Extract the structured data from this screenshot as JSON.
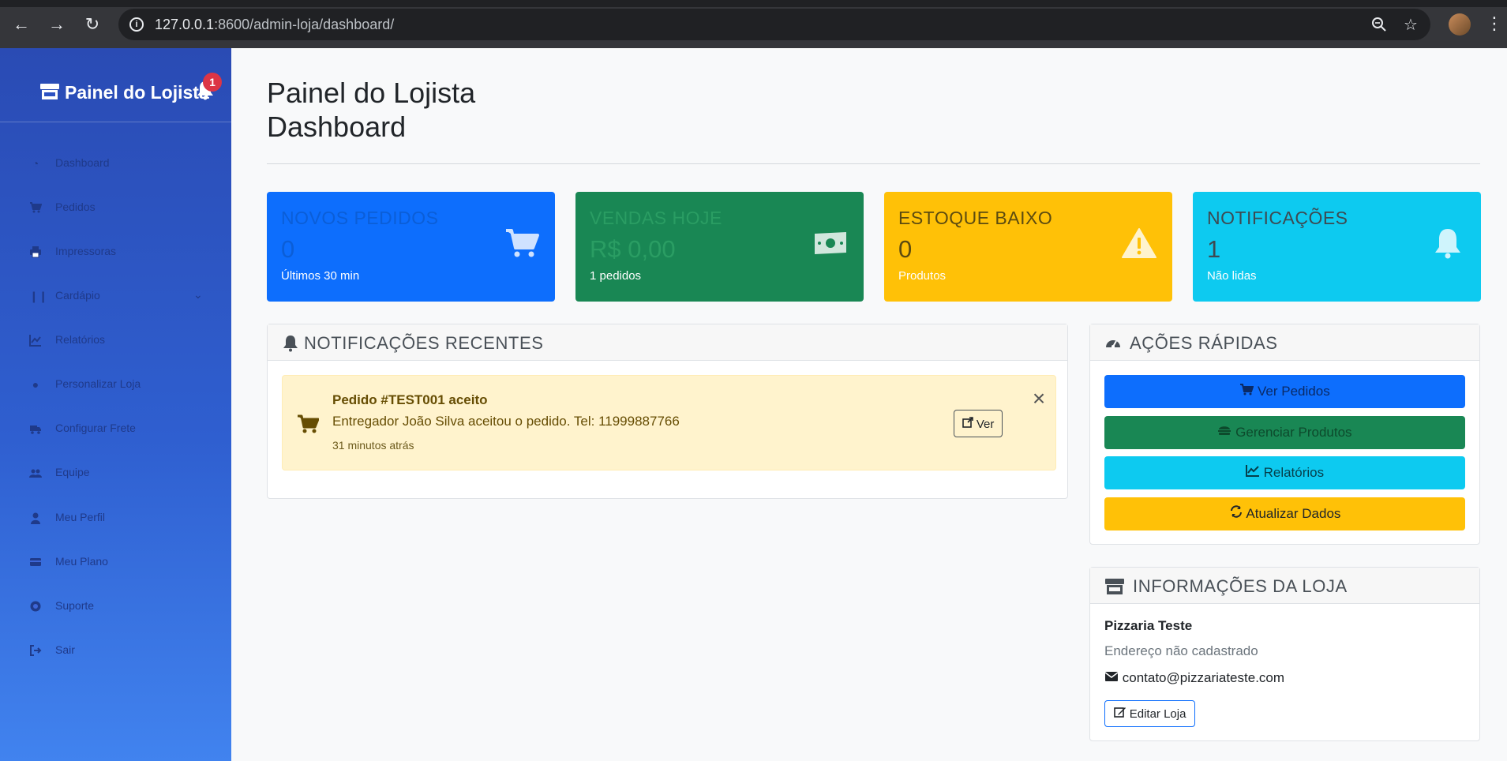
{
  "browser": {
    "url_host": "127.0.0.1",
    "url_path": ":8600/admin-loja/dashboard/"
  },
  "sidebar": {
    "brand": "Painel do Lojista",
    "notification_count": "1",
    "items": [
      {
        "label": "Dashboard",
        "icon": "gauge-icon"
      },
      {
        "label": "Pedidos",
        "icon": "cart-icon"
      },
      {
        "label": "Impressoras",
        "icon": "printer-icon"
      },
      {
        "label": "Cardápio",
        "icon": "utensils-icon"
      },
      {
        "label": "Relatórios",
        "icon": "chart-line-icon"
      },
      {
        "label": "Personalizar Loja",
        "icon": "palette-icon"
      },
      {
        "label": "Configurar Frete",
        "icon": "truck-icon"
      },
      {
        "label": "Equipe",
        "icon": "users-icon"
      },
      {
        "label": "Meu Perfil",
        "icon": "user-icon"
      },
      {
        "label": "Meu Plano",
        "icon": "credit-card-icon"
      },
      {
        "label": "Suporte",
        "icon": "life-ring-icon"
      },
      {
        "label": "Sair",
        "icon": "sign-out-icon"
      }
    ]
  },
  "header": {
    "title_line1": "Painel do Lojista",
    "title_line2": "Dashboard"
  },
  "stats": [
    {
      "title": "NOVOS PEDIDOS",
      "value": "0",
      "sub": "Últimos 30 min",
      "color": "#0d6efd",
      "icon": "cart-icon"
    },
    {
      "title": "VENDAS HOJE",
      "value": "R$ 0,00",
      "sub": "1 pedidos",
      "color": "#198754",
      "icon": "money-bill-icon"
    },
    {
      "title": "ESTOQUE BAIXO",
      "value": "0",
      "sub": "Produtos",
      "color": "#ffc107",
      "icon": "warning-icon"
    },
    {
      "title": "NOTIFICAÇÕES",
      "value": "1",
      "sub": "Não lidas",
      "color": "#0dcaf0",
      "icon": "bell-icon"
    }
  ],
  "notifications": {
    "header": "NOTIFICAÇÕES RECENTES",
    "item": {
      "title": "Pedido #TEST001 aceito",
      "message": "Entregador João Silva aceitou o pedido. Tel: 11999887766",
      "time": "31 minutos atrás",
      "button": "Ver"
    }
  },
  "quick_actions": {
    "header": "AÇÕES RÁPIDAS",
    "buttons": [
      {
        "label": "Ver Pedidos",
        "color": "#0d6efd"
      },
      {
        "label": "Gerenciar Produtos",
        "color": "#198754"
      },
      {
        "label": "Relatórios",
        "color": "#0dcaf0"
      },
      {
        "label": "Atualizar Dados",
        "color": "#ffc107"
      }
    ]
  },
  "store_info": {
    "header": "INFORMAÇÕES DA LOJA",
    "name": "Pizzaria Teste",
    "address": "Endereço não cadastrado",
    "email": "contato@pizzariateste.com",
    "edit_button": "Editar Loja"
  }
}
